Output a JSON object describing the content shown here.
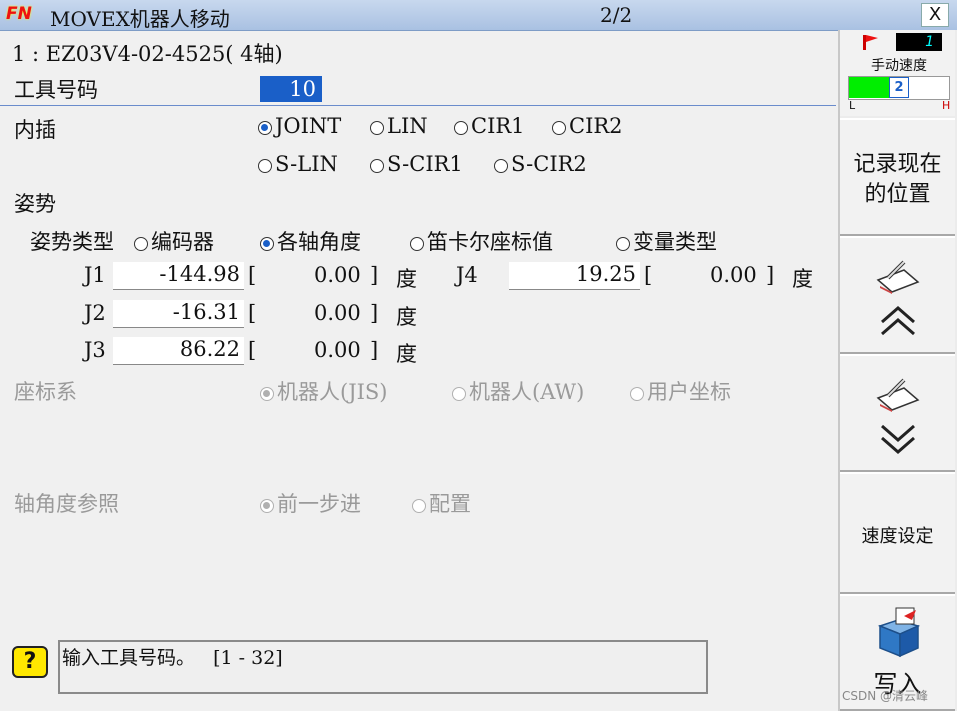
{
  "title": {
    "logo": "FN",
    "app": "MOVEX机器人移动",
    "page": "2/2",
    "close": "X"
  },
  "robot": {
    "line": "1 : EZ03V4-02-4525( 4轴)"
  },
  "tool": {
    "label": "工具号码",
    "value": "10"
  },
  "interp": {
    "label": "内插",
    "options": [
      "JOINT",
      "LIN",
      "CIR1",
      "CIR2",
      "S-LIN",
      "S-CIR1",
      "S-CIR2"
    ],
    "selected": "JOINT"
  },
  "pose": {
    "label": "姿势",
    "type_label": "姿势类型",
    "types": [
      "编码器",
      "各轴角度",
      "笛卡尔座标值",
      "变量类型"
    ],
    "selected": "各轴角度"
  },
  "joints": [
    {
      "name": "J1",
      "value": "-144.98",
      "ref": "0.00",
      "unit": "度"
    },
    {
      "name": "J2",
      "value": "-16.31",
      "ref": "0.00",
      "unit": "度"
    },
    {
      "name": "J3",
      "value": "86.22",
      "ref": "0.00",
      "unit": "度"
    },
    {
      "name": "J4",
      "value": "19.25",
      "ref": "0.00",
      "unit": "度"
    }
  ],
  "coord": {
    "label": "座标系",
    "options": [
      "机器人(JIS)",
      "机器人(AW)",
      "用户坐标"
    ],
    "selected": "机器人(JIS)"
  },
  "axis_ref": {
    "label": "轴角度参照",
    "options": [
      "前一步进",
      "配置"
    ],
    "selected": "前一步进"
  },
  "message": {
    "text": "输入工具号码。   [1 - 32]"
  },
  "sidebar": {
    "status_number": "1",
    "speed_label": "手动速度",
    "speed_value": "2",
    "speed_low": "L",
    "speed_high": "H",
    "record_btn": "记录现在\n的位置",
    "speed_set_btn": "速度设定",
    "write_btn": "写入"
  },
  "watermark": "CSDN @清云峰",
  "colors": {
    "accent": "#1a5fc8",
    "speed_bar": "#00ee00",
    "help": "#ffe800"
  }
}
